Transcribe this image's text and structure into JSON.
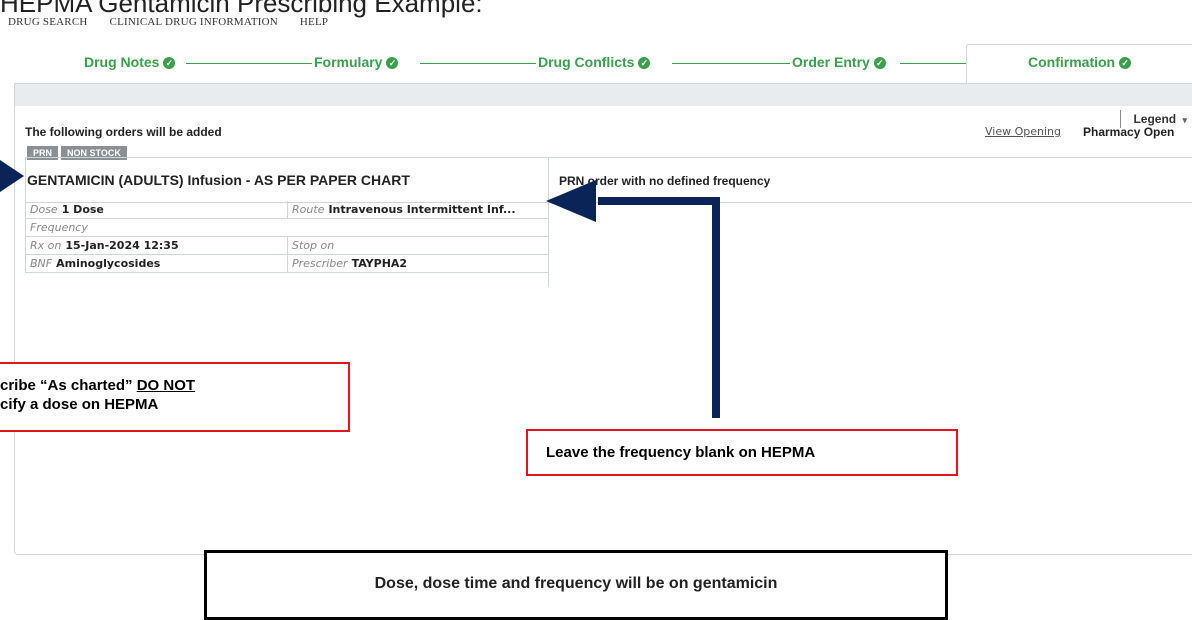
{
  "slide_title": "HEPMA Gentamicin Prescribing Example:",
  "top_nav": {
    "drug_search": "DRUG SEARCH",
    "clinical_drug_information": "CLINICAL DRUG INFORMATION",
    "help": "HELP"
  },
  "workflow_steps": [
    {
      "label": "Drug Notes",
      "state": "done"
    },
    {
      "label": "Formulary",
      "state": "done"
    },
    {
      "label": "Drug Conflicts",
      "state": "done"
    },
    {
      "label": "Order Entry",
      "state": "done"
    },
    {
      "label": "Confirmation",
      "state": "active"
    }
  ],
  "legend_label": "Legend",
  "orders": {
    "heading": "The following orders will be added",
    "view_opening": "View Opening",
    "pharmacy_open": "Pharmacy Open",
    "badges": [
      "PRN",
      "NON STOCK"
    ],
    "drug_title": "GENTAMICIN (ADULTS) Infusion - AS PER PAPER CHART",
    "note": "PRN order with no defined frequency",
    "details": {
      "dose_label": "Dose",
      "dose_value": "1 Dose",
      "route_label": "Route",
      "route_value": "Intravenous Intermittent Inf...",
      "frequency_label": "Frequency",
      "frequency_value": "",
      "rx_on_label": "Rx on",
      "rx_on_value": "15-Jan-2024 12:35",
      "stop_on_label": "Stop on",
      "stop_on_value": "",
      "bnf_label": "BNF",
      "bnf_value": "Aminoglycosides",
      "prescriber_label": "Prescriber",
      "prescriber_value": "TAYPHA2"
    }
  },
  "callouts": {
    "prescribe_prefix": "cribe “As charted” ",
    "do_not": "DO NOT",
    "prescribe_line2": "cify a dose on HEPMA",
    "frequency": "Leave the frequency blank on HEPMA",
    "bottom": "Dose, dose time and frequency will be on gentamicin"
  },
  "colors": {
    "step_green": "#3aa14a",
    "callout_red": "#e0171f",
    "arrow_navy": "#0b2457"
  }
}
